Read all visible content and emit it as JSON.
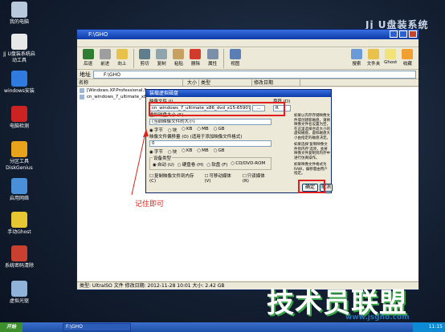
{
  "watermark": "Jj U盘装系统",
  "desktop_icons": [
    "我的电脑",
    "Jj U盘装系统启动工具",
    "windows安装",
    "电脑检测",
    "分区工具 DiskGenius",
    "启用网络",
    "手动Ghost",
    "系统密码清除",
    "虚拟光驱"
  ],
  "window": {
    "title": "F:\\GHO",
    "toolbar": [
      "后退",
      "前进",
      "向上",
      "剪切",
      "复制",
      "粘贴",
      "删除",
      "属性",
      "视图",
      "搜索",
      "文件夹",
      "Ghost",
      "收藏"
    ],
    "address_label": "地址",
    "address": "F:\\GHO",
    "columns": [
      "名称",
      "大小",
      "类型",
      "修改日期"
    ],
    "files": [
      "[Windows.XP.Professional.SP3]",
      "cn_windows_7_ultimate_x86"
    ],
    "status": "类型: UltraISO 文件 修改日期: 2012-11-28 10:01 大小: 2.42 GB"
  },
  "dialog": {
    "title": "装载虚拟磁盘",
    "image_file_label": "映像文件 (I)",
    "image_file_value": "cn_windows_7_ultimate_x86_dvd_x15-65907.iso",
    "browse_button": "...",
    "drive_label": "盘符 (D)",
    "drive_value": "R",
    "vdisk_size_label": "虚拟磁盘大小 (S)",
    "vdisk_size_value": "(当前映像文件的大小)",
    "size_units": [
      "字节",
      "块",
      "KB",
      "MB",
      "GB"
    ],
    "offset_label": "映像文件偏移量 (O)",
    "offset_note": "(适用于添加映像文件格式)",
    "offset_value": "0",
    "offset_units": [
      "字节",
      "块",
      "KB",
      "MB",
      "GB"
    ],
    "device_type_label": "设备类型",
    "device_types": [
      "自动 (U)",
      "硬盘卷 (H)",
      "软盘 (F)",
      "CD/DVD-ROM"
    ],
    "checkboxes": [
      "复制映像文件到内存 (C)",
      "可移动媒体 (V)",
      "只读媒体 (R)"
    ],
    "help_text": [
      "如果以内存存储映像文件或创建新磁盘，请将映像文件名设置为空，在这里选择合适大小的虚拟磁盘，虚拟磁盘大小由指定的磁盘决定。",
      "如果选择'复制映像文件到内存'选项，会将映像文件复制到内存中进行仿真操作。",
      "如果映像文件格式为RAW，偏移量由用户指定。",
      "如果选择'可移动媒体'的话，请确认...选择可移动媒体后，映像文件将以只读方式挂载..."
    ],
    "ok_button": "确定",
    "cancel_button": "取消"
  },
  "annotation": "记住即可",
  "taskbar": {
    "start": "开始",
    "task": "F:\\GHO",
    "time": "11:15"
  },
  "brand": "技术员联盟",
  "site": "www.jsgho.com"
}
